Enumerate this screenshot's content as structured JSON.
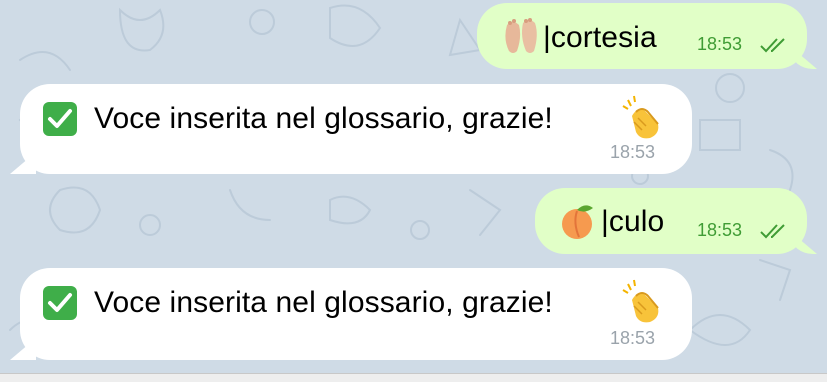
{
  "colors": {
    "chat_background": "#cfdbe6",
    "outgoing_bubble": "#e1ffc7",
    "incoming_bubble": "#ffffff",
    "outgoing_time": "#3f9c35",
    "incoming_time": "#9aa3ab"
  },
  "messages": [
    {
      "direction": "outgoing",
      "emoji": "feet-emoji",
      "text": "|cortesia",
      "time": "18:53",
      "status": "read-double-check"
    },
    {
      "direction": "incoming",
      "emoji": "check-mark-button-emoji",
      "text": "Voce inserita nel glossario, grazie!",
      "trailing_emoji": "clapping-hands-emoji",
      "time": "18:53"
    },
    {
      "direction": "outgoing",
      "emoji": "peach-emoji",
      "text": "|culo",
      "time": "18:53",
      "status": "read-double-check"
    },
    {
      "direction": "incoming",
      "emoji": "check-mark-button-emoji",
      "text": "Voce inserita nel glossario, grazie!",
      "trailing_emoji": "clapping-hands-emoji",
      "time": "18:53"
    }
  ]
}
